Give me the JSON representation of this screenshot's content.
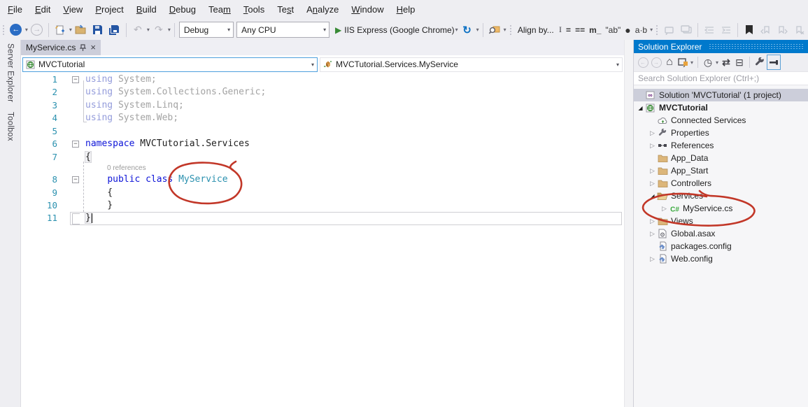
{
  "colors": {
    "accent_blue": "#0079cc",
    "chrome_bg": "#eeeef2",
    "keyword_blue": "#0d14d8",
    "type_teal": "#2b91af",
    "folder_gold": "#dcb67a",
    "csharp_green": "#37a93c",
    "run_green": "#388a34",
    "selection_gray": "#ccceda",
    "annotation_red": "#c23728",
    "solution_purple": "#68217a"
  },
  "menu": {
    "items": [
      {
        "key": "file",
        "pre": "",
        "u": "F",
        "post": "ile"
      },
      {
        "key": "edit",
        "pre": "",
        "u": "E",
        "post": "dit"
      },
      {
        "key": "view",
        "pre": "",
        "u": "V",
        "post": "iew"
      },
      {
        "key": "project",
        "pre": "",
        "u": "P",
        "post": "roject"
      },
      {
        "key": "build",
        "pre": "",
        "u": "B",
        "post": "uild"
      },
      {
        "key": "debug",
        "pre": "",
        "u": "D",
        "post": "ebug"
      },
      {
        "key": "team",
        "pre": "Tea",
        "u": "m",
        "post": ""
      },
      {
        "key": "tools",
        "pre": "",
        "u": "T",
        "post": "ools"
      },
      {
        "key": "test",
        "pre": "Te",
        "u": "s",
        "post": "t"
      },
      {
        "key": "analyze",
        "pre": "A",
        "u": "n",
        "post": "alyze"
      },
      {
        "key": "window",
        "pre": "",
        "u": "W",
        "post": "indow"
      },
      {
        "key": "help",
        "pre": "",
        "u": "H",
        "post": "elp"
      }
    ]
  },
  "toolbar": {
    "debug_label": "Debug",
    "platform_label": "Any CPU",
    "run_label": "IIS Express (Google Chrome)",
    "align_by_label": "Align by..."
  },
  "icons": {
    "back_arrow": "←",
    "forward_arrow": "→",
    "dropdown_caret": "▾",
    "undo_arrow": "↶",
    "redo_arrow": "↷",
    "run_play": "▶",
    "refresh_arrow": "↻",
    "close": "×",
    "ibeam": "I",
    "eq": "=",
    "eq2": "==",
    "m_underscore": "m_",
    "quoted_ab": "\"ab\"",
    "black_dot": "●",
    "a_dot_b": "a·b",
    "home": "⌂",
    "clock": "◷",
    "sync": "⇄",
    "collapse_all": "⊟"
  },
  "left_rail": {
    "items": [
      "Server Explorer",
      "Toolbox"
    ]
  },
  "editor": {
    "tab": {
      "title": "MyService.cs"
    },
    "nav": {
      "project": "MVCTutorial",
      "member": "MVCTutorial.Services.MyService"
    },
    "codelens": "0 references",
    "lines": [
      {
        "n": "1",
        "fold": true,
        "segs": [
          {
            "t": "using",
            "c": "kw-dim"
          },
          {
            "t": " System;",
            "c": "dim"
          }
        ]
      },
      {
        "n": "2",
        "segs": [
          {
            "t": "using",
            "c": "kw-dim"
          },
          {
            "t": " System.Collections.Generic;",
            "c": "dim"
          }
        ]
      },
      {
        "n": "3",
        "segs": [
          {
            "t": "using",
            "c": "kw-dim"
          },
          {
            "t": " System.Linq;",
            "c": "dim"
          }
        ]
      },
      {
        "n": "4",
        "segs": [
          {
            "t": "using",
            "c": "kw-dim"
          },
          {
            "t": " System.Web;",
            "c": "dim"
          }
        ]
      },
      {
        "n": "5",
        "segs": []
      },
      {
        "n": "6",
        "fold": true,
        "segs": [
          {
            "t": "namespace",
            "c": "kw"
          },
          {
            "t": " MVCTutorial.Services",
            "c": "plain"
          }
        ]
      },
      {
        "n": "7",
        "segs": [
          {
            "t": "{",
            "c": "brace-hl"
          }
        ]
      },
      {
        "n": "8",
        "fold": true,
        "codelens": true,
        "segs": [
          {
            "t": "    ",
            "c": "plain"
          },
          {
            "t": "public",
            "c": "kw"
          },
          {
            "t": " ",
            "c": "plain"
          },
          {
            "t": "class",
            "c": "kw"
          },
          {
            "t": " ",
            "c": "plain"
          },
          {
            "t": "MyService",
            "c": "type"
          }
        ]
      },
      {
        "n": "9",
        "segs": [
          {
            "t": "    {",
            "c": "plain"
          }
        ]
      },
      {
        "n": "10",
        "segs": [
          {
            "t": "    }",
            "c": "plain"
          }
        ]
      },
      {
        "n": "11",
        "current": true,
        "segs": [
          {
            "t": "}",
            "c": "brace-hl"
          }
        ]
      }
    ]
  },
  "solution_explorer": {
    "title": "Solution Explorer",
    "search_placeholder": "Search Solution Explorer (Ctrl+;)",
    "tree": [
      {
        "label": "Solution 'MVCTutorial' (1 project)",
        "icon": "solution",
        "indent": 0,
        "selected": true
      },
      {
        "label": "MVCTutorial",
        "icon": "project",
        "indent": 0,
        "arrow": "expanded",
        "bold": true
      },
      {
        "label": "Connected Services",
        "icon": "cloud",
        "indent": 1
      },
      {
        "label": "Properties",
        "icon": "wrench",
        "indent": 1,
        "arrow": "collapsed"
      },
      {
        "label": "References",
        "icon": "references",
        "indent": 1,
        "arrow": "collapsed"
      },
      {
        "label": "App_Data",
        "icon": "folder",
        "indent": 1
      },
      {
        "label": "App_Start",
        "icon": "folder",
        "indent": 1,
        "arrow": "collapsed"
      },
      {
        "label": "Controllers",
        "icon": "folder",
        "indent": 1,
        "arrow": "collapsed"
      },
      {
        "label": "Services",
        "icon": "folder-open",
        "indent": 1,
        "arrow": "expanded"
      },
      {
        "label": "MyService.cs",
        "icon": "csharp",
        "indent": 2,
        "arrow": "collapsed"
      },
      {
        "label": "Views",
        "icon": "folder",
        "indent": 1,
        "arrow": "collapsed"
      },
      {
        "label": "Global.asax",
        "icon": "asax",
        "indent": 1,
        "arrow": "collapsed"
      },
      {
        "label": "packages.config",
        "icon": "config",
        "indent": 1
      },
      {
        "label": "Web.config",
        "icon": "config",
        "indent": 1,
        "arrow": "collapsed"
      }
    ]
  }
}
